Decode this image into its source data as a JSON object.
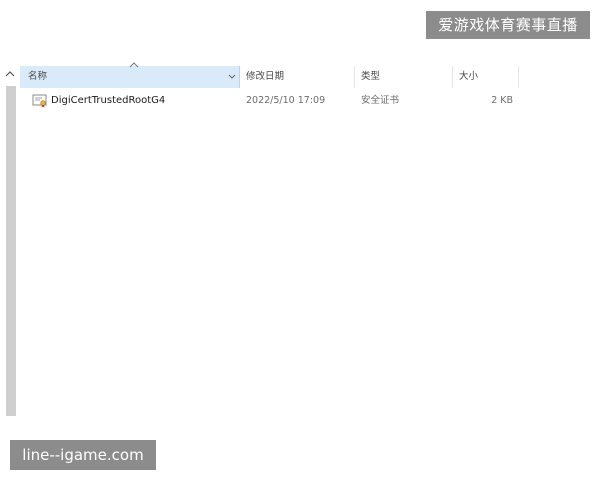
{
  "watermarks": {
    "top_right": "爱游戏体育赛事直播",
    "bottom_left": "line--igame.com"
  },
  "columns": {
    "name": "名称",
    "date_modified": "修改日期",
    "type": "类型",
    "size": "大小"
  },
  "sort": {
    "column": "name",
    "direction": "ascending"
  },
  "files": [
    {
      "name": "DigiCertTrustedRootG4",
      "date_modified": "2022/5/10 17:09",
      "type": "安全证书",
      "size": "2 KB",
      "icon": "certificate-icon"
    }
  ],
  "colors": {
    "header_selected": "#d9ebf9",
    "watermark_bg": "#8c8c8c",
    "muted_text": "#6d6d6d"
  }
}
